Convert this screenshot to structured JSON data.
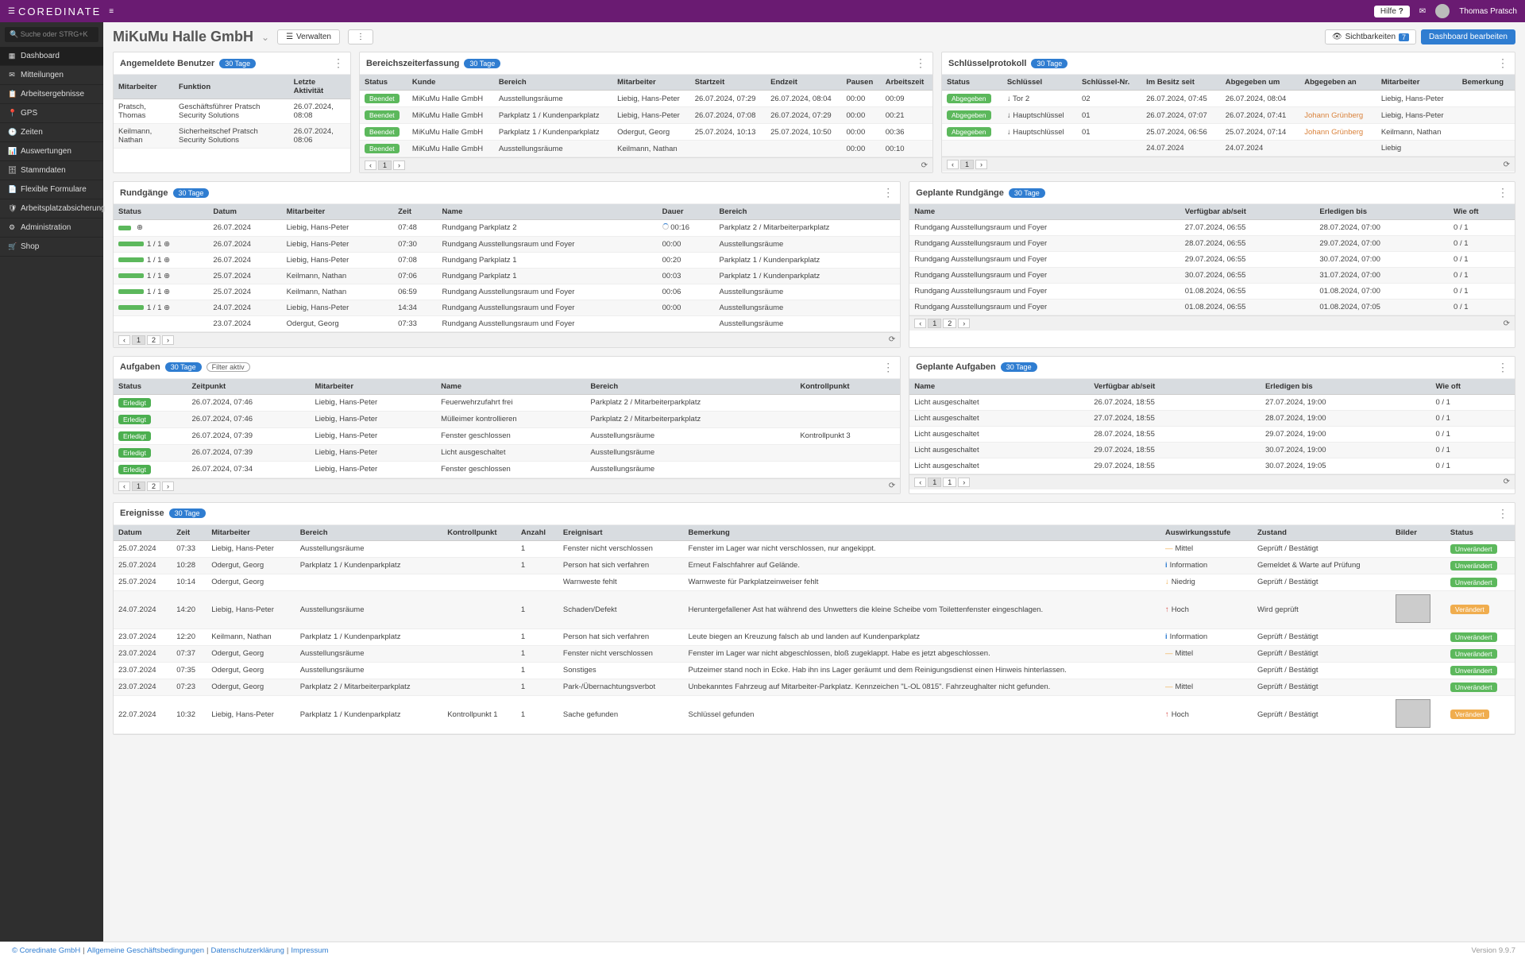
{
  "topbar": {
    "brand": "COREDINATE",
    "help": "Hilfe",
    "user": "Thomas Pratsch"
  },
  "sidebar": {
    "search": "Suche oder STRG+K",
    "items": [
      "Dashboard",
      "Mitteilungen",
      "Arbeitsergebnisse",
      "GPS",
      "Zeiten",
      "Auswertungen",
      "Stammdaten",
      "Flexible Formulare",
      "Arbeitsplatzabsicherung",
      "Administration",
      "Shop"
    ]
  },
  "page": {
    "title": "MiKuMu Halle GmbH",
    "manage": "Verwalten",
    "vis_label": "Sichtbarkeiten",
    "vis_count": "7",
    "edit": "Dashboard bearbeiten"
  },
  "badges": {
    "d30": "30 Tage",
    "filter": "Filter aktiv"
  },
  "users": {
    "title": "Angemeldete Benutzer",
    "cols": [
      "Mitarbeiter",
      "Funktion",
      "Letzte Aktivität"
    ],
    "rows": [
      [
        "Pratsch, Thomas",
        "Geschäftsführer Pratsch Security Solutions",
        "26.07.2024, 08:08"
      ],
      [
        "Keilmann, Nathan",
        "Sicherheitschef Pratsch Security Solutions",
        "26.07.2024, 08:06"
      ]
    ]
  },
  "area": {
    "title": "Bereichszeiterfassung",
    "cols": [
      "Status",
      "Kunde",
      "Bereich",
      "Mitarbeiter",
      "Startzeit",
      "Endzeit",
      "Pausen",
      "Arbeitszeit"
    ],
    "rows": [
      [
        "Beendet",
        "MiKuMu Halle GmbH",
        "Ausstellungsräume",
        "Liebig, Hans-Peter",
        "26.07.2024, 07:29",
        "26.07.2024, 08:04",
        "00:00",
        "00:09"
      ],
      [
        "Beendet",
        "MiKuMu Halle GmbH",
        "Parkplatz 1 / Kundenparkplatz",
        "Liebig, Hans-Peter",
        "26.07.2024, 07:08",
        "26.07.2024, 07:29",
        "00:00",
        "00:21"
      ],
      [
        "Beendet",
        "MiKuMu Halle GmbH",
        "Parkplatz 1 / Kundenparkplatz",
        "Odergut, Georg",
        "25.07.2024, 10:13",
        "25.07.2024, 10:50",
        "00:00",
        "00:36"
      ],
      [
        "Beendet",
        "MiKuMu Halle GmbH",
        "Ausstellungsräume",
        "Keilmann, Nathan",
        "",
        "",
        "00:00",
        "00:10"
      ]
    ]
  },
  "keys": {
    "title": "Schlüsselprotokoll",
    "cols": [
      "Status",
      "Schlüssel",
      "Schlüssel-Nr.",
      "Im Besitz seit",
      "Abgegeben um",
      "Abgegeben an",
      "Mitarbeiter",
      "Bemerkung"
    ],
    "rows": [
      [
        "Abgegeben",
        "↓ Tor 2",
        "02",
        "26.07.2024, 07:45",
        "26.07.2024, 08:04",
        "",
        "Liebig, Hans-Peter",
        ""
      ],
      [
        "Abgegeben",
        "↓ Hauptschlüssel",
        "01",
        "26.07.2024, 07:07",
        "26.07.2024, 07:41",
        "Johann Grünberg",
        "Liebig, Hans-Peter",
        ""
      ],
      [
        "Abgegeben",
        "↓ Hauptschlüssel",
        "01",
        "25.07.2024, 06:56",
        "25.07.2024, 07:14",
        "Johann Grünberg",
        "Keilmann, Nathan",
        ""
      ],
      [
        "",
        "",
        "",
        "24.07.2024",
        "24.07.2024",
        "",
        "Liebig",
        ""
      ]
    ]
  },
  "rounds": {
    "title": "Rundgänge",
    "cols": [
      "Status",
      "Datum",
      "Mitarbeiter",
      "Zeit",
      "Name",
      "Dauer",
      "Bereich"
    ],
    "rows": [
      [
        "open",
        "26.07.2024",
        "Liebig, Hans-Peter",
        "07:48",
        "Rundgang Parkplatz 2",
        "00:16",
        "Parkplatz 2 / Mitarbeiterparkplatz"
      ],
      [
        "1 / 1",
        "26.07.2024",
        "Liebig, Hans-Peter",
        "07:30",
        "Rundgang Ausstellungsraum und Foyer",
        "00:00",
        "Ausstellungsräume"
      ],
      [
        "1 / 1",
        "26.07.2024",
        "Liebig, Hans-Peter",
        "07:08",
        "Rundgang Parkplatz 1",
        "00:20",
        "Parkplatz 1 / Kundenparkplatz"
      ],
      [
        "1 / 1",
        "25.07.2024",
        "Keilmann, Nathan",
        "07:06",
        "Rundgang Parkplatz 1",
        "00:03",
        "Parkplatz 1 / Kundenparkplatz"
      ],
      [
        "1 / 1",
        "25.07.2024",
        "Keilmann, Nathan",
        "06:59",
        "Rundgang Ausstellungsraum und Foyer",
        "00:06",
        "Ausstellungsräume"
      ],
      [
        "1 / 1",
        "24.07.2024",
        "Liebig, Hans-Peter",
        "14:34",
        "Rundgang Ausstellungsraum und Foyer",
        "00:00",
        "Ausstellungsräume"
      ],
      [
        "",
        "23.07.2024",
        "Odergut, Georg",
        "07:33",
        "Rundgang Ausstellungsraum und Foyer",
        "",
        "Ausstellungsräume"
      ]
    ]
  },
  "plannedRounds": {
    "title": "Geplante Rundgänge",
    "cols": [
      "Name",
      "Verfügbar ab/seit",
      "Erledigen bis",
      "Wie oft"
    ],
    "rows": [
      [
        "Rundgang Ausstellungsraum und Foyer",
        "27.07.2024, 06:55",
        "28.07.2024, 07:00",
        "0 / 1"
      ],
      [
        "Rundgang Ausstellungsraum und Foyer",
        "28.07.2024, 06:55",
        "29.07.2024, 07:00",
        "0 / 1"
      ],
      [
        "Rundgang Ausstellungsraum und Foyer",
        "29.07.2024, 06:55",
        "30.07.2024, 07:00",
        "0 / 1"
      ],
      [
        "Rundgang Ausstellungsraum und Foyer",
        "30.07.2024, 06:55",
        "31.07.2024, 07:00",
        "0 / 1"
      ],
      [
        "Rundgang Ausstellungsraum und Foyer",
        "01.08.2024, 06:55",
        "01.08.2024, 07:00",
        "0 / 1"
      ],
      [
        "Rundgang Ausstellungsraum und Foyer",
        "01.08.2024, 06:55",
        "01.08.2024, 07:05",
        "0 / 1"
      ]
    ]
  },
  "tasks": {
    "title": "Aufgaben",
    "cols": [
      "Status",
      "Zeitpunkt",
      "Mitarbeiter",
      "Name",
      "Bereich",
      "Kontrollpunkt"
    ],
    "rows": [
      [
        "Erledigt",
        "26.07.2024, 07:46",
        "Liebig, Hans-Peter",
        "Feuerwehrzufahrt frei",
        "Parkplatz 2 / Mitarbeiterparkplatz",
        ""
      ],
      [
        "Erledigt",
        "26.07.2024, 07:46",
        "Liebig, Hans-Peter",
        "Mülleimer kontrollieren",
        "Parkplatz 2 / Mitarbeiterparkplatz",
        ""
      ],
      [
        "Erledigt",
        "26.07.2024, 07:39",
        "Liebig, Hans-Peter",
        "Fenster geschlossen",
        "Ausstellungsräume",
        "Kontrollpunkt 3"
      ],
      [
        "Erledigt",
        "26.07.2024, 07:39",
        "Liebig, Hans-Peter",
        "Licht ausgeschaltet",
        "Ausstellungsräume",
        ""
      ],
      [
        "Erledigt",
        "26.07.2024, 07:34",
        "Liebig, Hans-Peter",
        "Fenster geschlossen",
        "Ausstellungsräume",
        ""
      ]
    ]
  },
  "plannedTasks": {
    "title": "Geplante Aufgaben",
    "cols": [
      "Name",
      "Verfügbar ab/seit",
      "Erledigen bis",
      "Wie oft"
    ],
    "rows": [
      [
        "Licht ausgeschaltet",
        "26.07.2024, 18:55",
        "27.07.2024, 19:00",
        "0 / 1"
      ],
      [
        "Licht ausgeschaltet",
        "27.07.2024, 18:55",
        "28.07.2024, 19:00",
        "0 / 1"
      ],
      [
        "Licht ausgeschaltet",
        "28.07.2024, 18:55",
        "29.07.2024, 19:00",
        "0 / 1"
      ],
      [
        "Licht ausgeschaltet",
        "29.07.2024, 18:55",
        "30.07.2024, 19:00",
        "0 / 1"
      ],
      [
        "Licht ausgeschaltet",
        "29.07.2024, 18:55",
        "30.07.2024, 19:05",
        "0 / 1"
      ]
    ]
  },
  "events": {
    "title": "Ereignisse",
    "cols": [
      "Datum",
      "Zeit",
      "Mitarbeiter",
      "Bereich",
      "Kontrollpunkt",
      "Anzahl",
      "Ereignisart",
      "Bemerkung",
      "Auswirkungsstufe",
      "Zustand",
      "Bilder",
      "Status"
    ],
    "rows": [
      [
        "25.07.2024",
        "07:33",
        "Liebig, Hans-Peter",
        "Ausstellungsräume",
        "",
        "1",
        "Fenster nicht verschlossen",
        "Fenster im Lager war nicht verschlossen, nur angekippt.",
        "Mittel",
        "Geprüft / Bestätigt",
        "",
        "Unverändert"
      ],
      [
        "25.07.2024",
        "10:28",
        "Odergut, Georg",
        "Parkplatz 1 / Kundenparkplatz",
        "",
        "1",
        "Person hat sich verfahren",
        "Erneut Falschfahrer auf Gelände.",
        "Information",
        "Gemeldet & Warte auf Prüfung",
        "",
        "Unverändert"
      ],
      [
        "25.07.2024",
        "10:14",
        "Odergut, Georg",
        "",
        "",
        "",
        "Warnweste fehlt",
        "Warnweste für Parkplatzeinweiser fehlt",
        "Niedrig",
        "Geprüft / Bestätigt",
        "",
        "Unverändert"
      ],
      [
        "24.07.2024",
        "14:20",
        "Liebig, Hans-Peter",
        "Ausstellungsräume",
        "",
        "1",
        "Schaden/Defekt",
        "Heruntergefallener Ast hat während des Unwetters die kleine Scheibe vom Toilettenfenster eingeschlagen.",
        "Hoch",
        "Wird geprüft",
        "img",
        "Verändert"
      ],
      [
        "23.07.2024",
        "12:20",
        "Keilmann, Nathan",
        "Parkplatz 1 / Kundenparkplatz",
        "",
        "1",
        "Person hat sich verfahren",
        "Leute biegen an Kreuzung falsch ab und landen auf Kundenparkplatz",
        "Information",
        "Geprüft / Bestätigt",
        "",
        "Unverändert"
      ],
      [
        "23.07.2024",
        "07:37",
        "Odergut, Georg",
        "Ausstellungsräume",
        "",
        "1",
        "Fenster nicht verschlossen",
        "Fenster im Lager war nicht abgeschlossen, bloß zugeklappt. Habe es jetzt abgeschlossen.",
        "Mittel",
        "Geprüft / Bestätigt",
        "",
        "Unverändert"
      ],
      [
        "23.07.2024",
        "07:35",
        "Odergut, Georg",
        "Ausstellungsräume",
        "",
        "1",
        "Sonstiges",
        "Putzeimer stand noch in Ecke. Hab ihn ins Lager geräumt und dem Reinigungsdienst einen Hinweis hinterlassen.",
        "",
        "Geprüft / Bestätigt",
        "",
        "Unverändert"
      ],
      [
        "23.07.2024",
        "07:23",
        "Odergut, Georg",
        "Parkplatz 2 / Mitarbeiterparkplatz",
        "",
        "1",
        "Park-/Übernachtungsverbot",
        "Unbekanntes Fahrzeug auf Mitarbeiter-Parkplatz. Kennzeichen \"L-OL 0815\". Fahrzeughalter nicht gefunden.",
        "Mittel",
        "Geprüft / Bestätigt",
        "",
        "Unverändert"
      ],
      [
        "22.07.2024",
        "10:32",
        "Liebig, Hans-Peter",
        "Parkplatz 1 / Kundenparkplatz",
        "Kontrollpunkt 1",
        "1",
        "Sache gefunden",
        "Schlüssel gefunden",
        "Hoch",
        "Geprüft / Bestätigt",
        "img",
        "Verändert"
      ]
    ]
  },
  "footer": {
    "copy": "© Coredinate GmbH",
    "agb": "Allgemeine Geschäftsbedingungen",
    "ds": "Datenschutzerklärung",
    "imp": "Impressum",
    "ver": "Version 9.9.7"
  }
}
